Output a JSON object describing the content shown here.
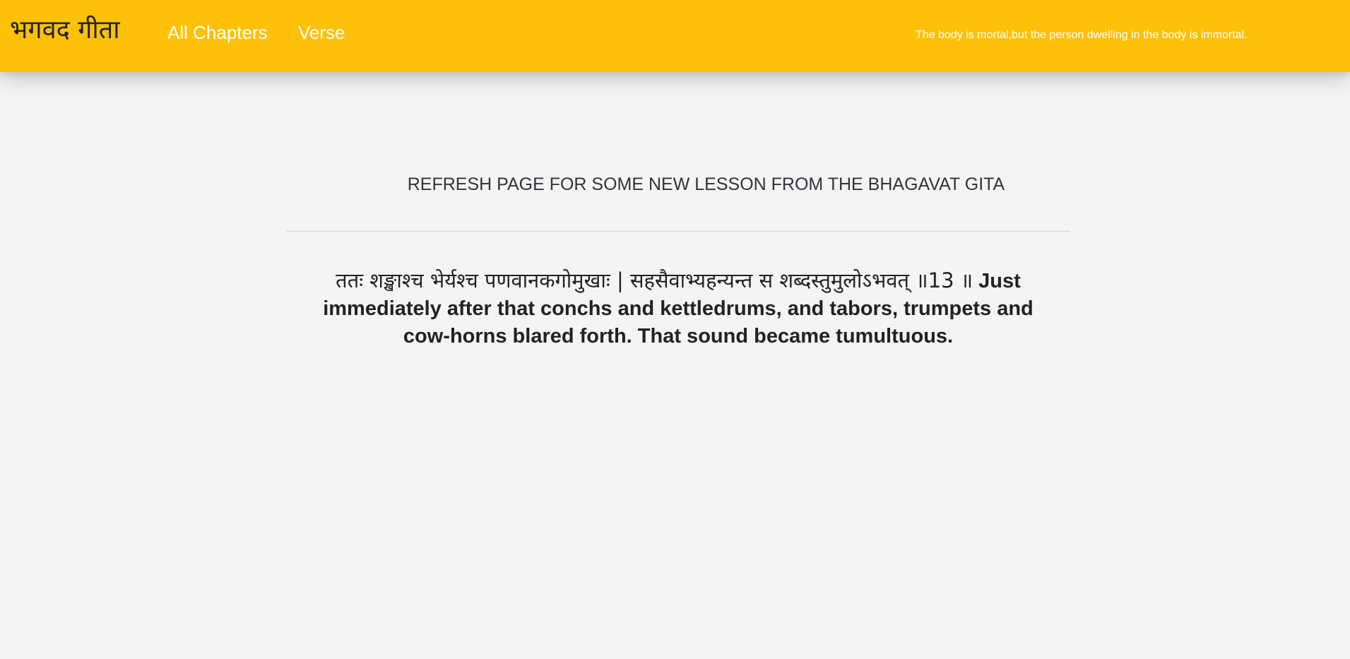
{
  "navbar": {
    "brand": "भगवद गीता",
    "links": [
      {
        "label": "All Chapters"
      },
      {
        "label": "Verse"
      }
    ],
    "quote": "The body is mortal,but the person dwelling in the body is immortal."
  },
  "main": {
    "heading": "REFRESH PAGE FOR SOME NEW LESSON FROM THE BHAGAVAT GITA",
    "verse": {
      "sanskrit": "ततः शङ्खाश्च भेर्यश्च पणवानकगोमुखाः | सहसैवाभ्यहन्यन्त स शब्दस्तुमुलोऽभवत् ॥13 ॥",
      "translation": "Just immediately after that conchs and kettledrums, and tabors, trumpets and cow-horns blared forth. That sound became tumultuous."
    }
  },
  "colors": {
    "navbar_bg": "#ffc107",
    "page_bg": "#f4f4f4",
    "heading_text": "#2f353b",
    "nav_text": "#ffffff"
  }
}
